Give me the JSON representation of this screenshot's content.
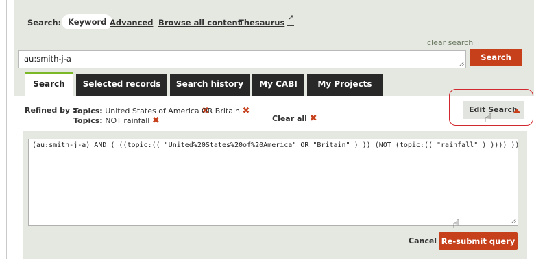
{
  "search_nav": {
    "label": "Search:",
    "active_mode": "Keyword",
    "links": [
      "Advanced",
      "Browse all content",
      "Thesaurus"
    ]
  },
  "clear_search": "clear search",
  "search_input_value": "au:smith-j-a",
  "search_button": "Search",
  "tabs": [
    "Search",
    "Selected records",
    "Search history",
    "My CABI",
    "My Projects"
  ],
  "refined": {
    "label": "Refined by :",
    "topics_label": "Topics:",
    "topic_1": "United States of America",
    "topic_2": "OR Britain",
    "topic_3": "NOT rainfall",
    "clear_all": "Clear all"
  },
  "edit_search": "Edit Search",
  "query_text": "(au:smith-j-a) AND  ( ((topic:(( \"United%20States%20of%20America\" OR \"Britain\" ) )) (NOT (topic:(( \"rainfall\" ) )))) ))",
  "cancel": "Cancel",
  "resubmit": "Re-submit query",
  "colors": {
    "accent": "#c7401c",
    "tab_bar": "#282828",
    "panel": "#e4e8e1",
    "tab_active_border": "#7ab828",
    "highlight_circle": "#d2282f"
  }
}
